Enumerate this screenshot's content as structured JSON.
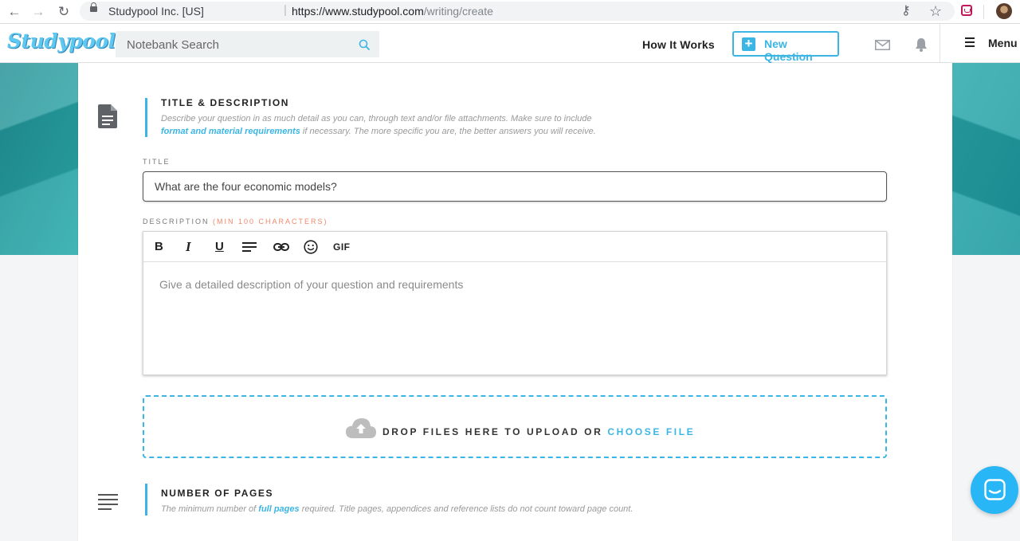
{
  "browser": {
    "back_icon": "arrow-left-icon",
    "forward_icon": "arrow-right-icon",
    "reload_icon": "reload-icon",
    "site_name": "Studypool Inc. [US]",
    "url_host": "https://www.studypool.com",
    "url_path": "/writing/create"
  },
  "header": {
    "logo_text": "Studypool",
    "search_placeholder": "Notebank Search",
    "how_it_works": "How It Works",
    "new_question": "New Question",
    "menu": "Menu",
    "accent_color": "#3bb6e4"
  },
  "title_section": {
    "heading": "TITLE & DESCRIPTION",
    "desc_part1": "Describe your question in as much detail as you can, through text and/or file attachments. Make sure to include",
    "desc_link": "format and material requirements",
    "desc_part2": "if necessary. The more specific you are, the better answers you will receive."
  },
  "title_field": {
    "label": "TITLE",
    "value": "What are the four economic models?"
  },
  "description_field": {
    "label": "DESCRIPTION",
    "requirement": "(MIN 100 CHARACTERS)",
    "placeholder": "Give a detailed description of your question and requirements",
    "toolbar": {
      "bold": "B",
      "italic": "I",
      "underline": "U",
      "gif": "GIF"
    }
  },
  "dropzone": {
    "text": "DROP FILES HERE TO UPLOAD OR",
    "choose": "CHOOSE FILE"
  },
  "pages_section": {
    "heading": "NUMBER OF PAGES",
    "desc_part1": "The minimum number of",
    "desc_link": "full pages",
    "desc_part2": "required. Title pages, appendices and reference lists do not count toward page count."
  }
}
